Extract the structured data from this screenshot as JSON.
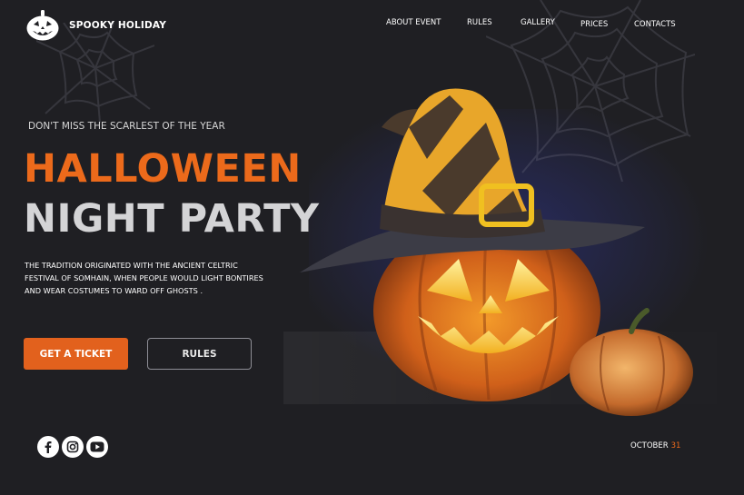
{
  "brand": {
    "name": "SPOOKY HOLIDAY",
    "logo_icon": "jack-o-lantern-icon"
  },
  "nav": {
    "items": [
      "ABOUT EVENT",
      "RULES",
      "GALLERY",
      "PRICES",
      "CONTACTS"
    ]
  },
  "hero": {
    "tagline": "DON'T MISS THE SCARLEST OF THE YEAR",
    "title_line1": "HALLOWEEN",
    "title_line2": "NIGHT PARTY",
    "description": "THE TRADITION ORIGINATED WITH THE ANCIENT  CELTRIC\nFESTIVAL OF SOMHAIN, WHEN PEOPLE  WOULD LIGHT BONTIRES\nAND WEAR COSTUMES  TO WARD OFF GHOSTS .",
    "primary_button": "GET A TICKET",
    "secondary_button": "RULES"
  },
  "social": [
    "facebook-icon",
    "instagram-icon",
    "youtube-icon"
  ],
  "event_date": {
    "month": "OCTOBER",
    "day": "31"
  },
  "colors": {
    "background": "#1f1f23",
    "accent": "#ec6a1b",
    "button": "#e2611d",
    "title_secondary": "#d4d4d6"
  }
}
